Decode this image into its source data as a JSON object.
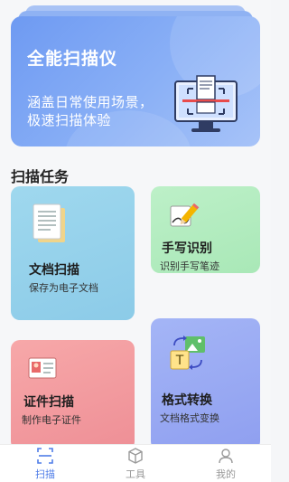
{
  "hero": {
    "title": "全能扫描仪",
    "line1": "涵盖日常使用场景，",
    "line2": "极速扫描体验"
  },
  "section": {
    "title": "扫描任务"
  },
  "cards": {
    "doc": {
      "title": "文档扫描",
      "desc": "保存为电子文档"
    },
    "hand": {
      "title": "手写识别",
      "desc": "识别手写笔迹"
    },
    "id": {
      "title": "证件扫描",
      "desc": "制作电子证件"
    },
    "fmt": {
      "title": "格式转换",
      "desc": "文档格式变换"
    }
  },
  "tabs": [
    {
      "label": "扫描",
      "icon": "scan-icon",
      "active": true
    },
    {
      "label": "工具",
      "icon": "box-icon",
      "active": false
    },
    {
      "label": "我的",
      "icon": "user-icon",
      "active": false
    }
  ],
  "colors": {
    "accent": "#4f7de8"
  }
}
